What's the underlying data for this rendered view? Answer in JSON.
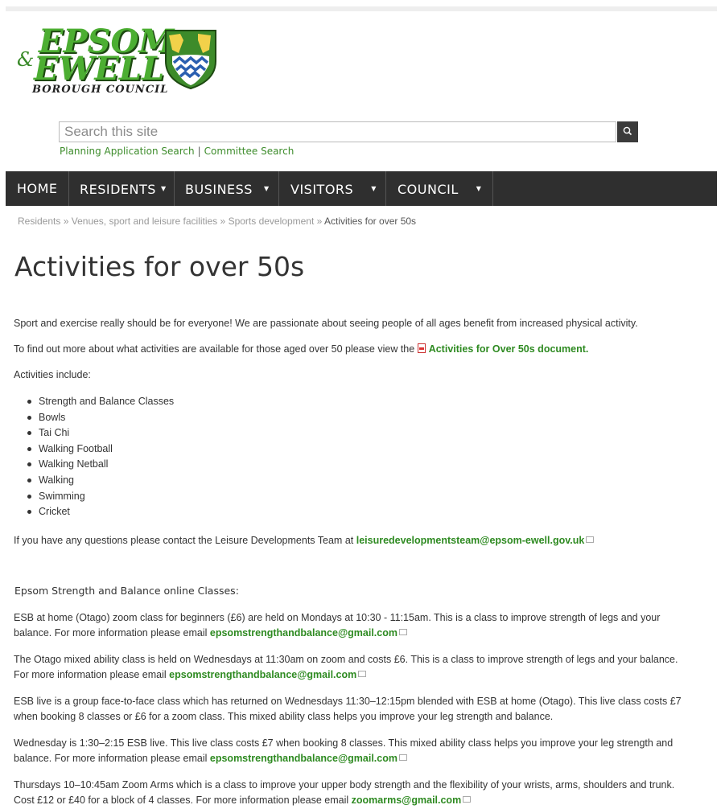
{
  "logo": {
    "line1": "EPSOM",
    "ampersand": "&",
    "line2": "EWELL",
    "subtitle": "BOROUGH COUNCIL",
    "icon": "council-crest-icon"
  },
  "search": {
    "placeholder": "Search this site",
    "button_icon": "search-icon",
    "link_planning": "Planning Application Search",
    "separator": "|",
    "link_committee": "Committee Search"
  },
  "nav": {
    "home": "HOME",
    "residents": "RESIDENTS",
    "business": "BUSINESS",
    "visitors": "VISITORS",
    "council": "COUNCIL",
    "dropdown_icon": "triangle-down-icon"
  },
  "breadcrumb": {
    "c1": "Residents",
    "sep": "»",
    "c2": "Venues, sport and leisure facilities",
    "c3": "Sports development",
    "current": "Activities for over 50s"
  },
  "page_title": "Activities for over 50s",
  "intro": "Sport and exercise really should be for everyone! We are passionate about seeing people of all ages benefit from increased physical activity.",
  "find_out": {
    "text": "To find out more about what activities are available for those aged over 50 please view the",
    "link": "Activities for Over 50s document."
  },
  "activities_intro": "Activities include:",
  "activities": [
    "Strength and Balance Classes",
    "Bowls",
    "Tai Chi",
    "Walking Football",
    "Walking Netball",
    "Walking",
    "Swimming",
    "Cricket"
  ],
  "contact": {
    "text": "If you have any questions please contact the Leisure Developments Team at",
    "email": "leisuredevelopmentsteam@epsom-ewell.gov.uk"
  },
  "classes_heading": "Epsom Strength and Balance online Classes:",
  "p1": {
    "line1": "ESB at home (Otago) zoom class for beginners (£6) are held on Mondays at 10:30 - 11:15am. This is a class to improve strength of legs and your",
    "line2": "balance. For more information please email",
    "email": "epsomstrengthandbalance@gmail.com"
  },
  "p2": {
    "line1": "The Otago mixed ability class is held on Wednesdays at 11:30am on zoom and costs £6. This is a class to improve strength of legs and your balance.",
    "line2": "For more information please email",
    "email": "epsomstrengthandbalance@gmail.com"
  },
  "p3": {
    "line1": "ESB live is a group face-to-face class which has returned on Wednesdays 11:30–12:15pm blended with ESB at home (Otago).  This live class costs £7",
    "line2": "when booking 8 classes or £6 for a zoom class.  This mixed ability class helps you improve your leg strength and balance."
  },
  "p4": {
    "line1": "Wednesday is 1:30–2:15 ESB live.  This live class costs £7 when booking 8 classes.  This mixed ability class helps you improve your leg strength and",
    "line2": "balance. For more information please email",
    "email": "epsomstrengthandbalance@gmail.com"
  },
  "p5": {
    "line1": "Thursdays 10–10:45am Zoom Arms which is a class to improve your upper body strength and the flexibility of your wrists, arms, shoulders and trunk.",
    "line2": "Cost £12 or £40 for  a block of 4 classes. For more information please email",
    "email": "zoomarms@gmail.com"
  },
  "colors": {
    "link_green": "#2e8a21",
    "nav_bg": "#2f2f2f",
    "logo_green": "#4cae32"
  }
}
